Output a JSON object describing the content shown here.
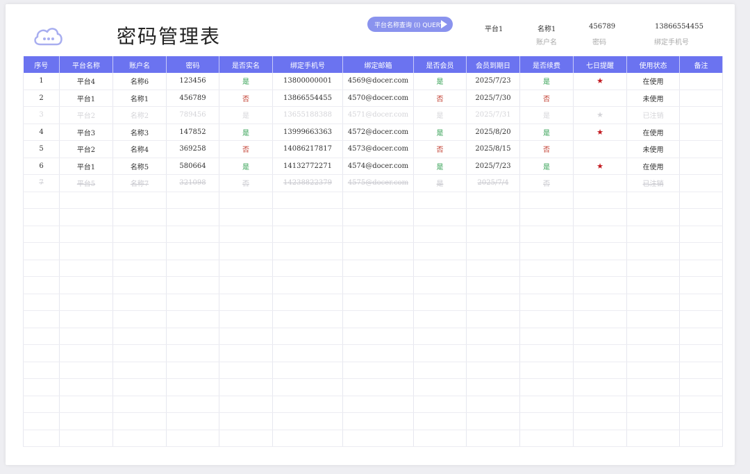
{
  "title": "密码管理表",
  "query": {
    "label": "平台名称查询 (I) QUERY"
  },
  "criteria": [
    {
      "value": "平台1",
      "label": ""
    },
    {
      "value": "名称1",
      "label": "账户名"
    },
    {
      "value": "456789",
      "label": "密码"
    },
    {
      "value": "13866554455",
      "label": "绑定手机号"
    }
  ],
  "columns": [
    "序号",
    "平台名称",
    "账户名",
    "密码",
    "是否实名",
    "绑定手机号",
    "绑定邮箱",
    "是否会员",
    "会员到期日",
    "是否续费",
    "七日提醒",
    "使用状态",
    "备注"
  ],
  "rows": [
    {
      "cells": [
        "1",
        "平台4",
        "名称6",
        "123456",
        "是",
        "13800000001",
        "4569@docer.com",
        "是",
        "2025/7/23",
        "是",
        "★",
        "在使用",
        ""
      ],
      "style": ""
    },
    {
      "cells": [
        "2",
        "平台1",
        "名称1",
        "456789",
        "否",
        "13866554455",
        "4570@docer.com",
        "否",
        "2025/7/30",
        "否",
        "",
        "未使用",
        ""
      ],
      "style": ""
    },
    {
      "cells": [
        "3",
        "平台2",
        "名称2",
        "789456",
        "是",
        "13655188388",
        "4571@docer.com",
        "是",
        "2025/7/31",
        "是",
        "★",
        "已注销",
        ""
      ],
      "style": "faded"
    },
    {
      "cells": [
        "4",
        "平台3",
        "名称3",
        "147852",
        "是",
        "13999663363",
        "4572@docer.com",
        "是",
        "2025/8/20",
        "是",
        "★",
        "在使用",
        ""
      ],
      "style": ""
    },
    {
      "cells": [
        "5",
        "平台2",
        "名称4",
        "369258",
        "否",
        "14086217817",
        "4573@docer.com",
        "否",
        "2025/8/15",
        "否",
        "",
        "未使用",
        ""
      ],
      "style": ""
    },
    {
      "cells": [
        "6",
        "平台1",
        "名称5",
        "580664",
        "是",
        "14132772271",
        "4574@docer.com",
        "是",
        "2025/7/23",
        "是",
        "★",
        "在使用",
        ""
      ],
      "style": ""
    },
    {
      "cells": [
        "7",
        "平台5",
        "名称7",
        "321098",
        "否",
        "14238822379",
        "4575@docer.com",
        "是",
        "2025/7/4",
        "否",
        "",
        "已注销",
        ""
      ],
      "style": "struck"
    }
  ],
  "empty_rows": 15,
  "colors": {
    "header_bg": "#6b73f0",
    "button_bg": "#8a93ee",
    "yes": "#2e9e4e",
    "no": "#c0392b",
    "star": "#c2181e"
  }
}
